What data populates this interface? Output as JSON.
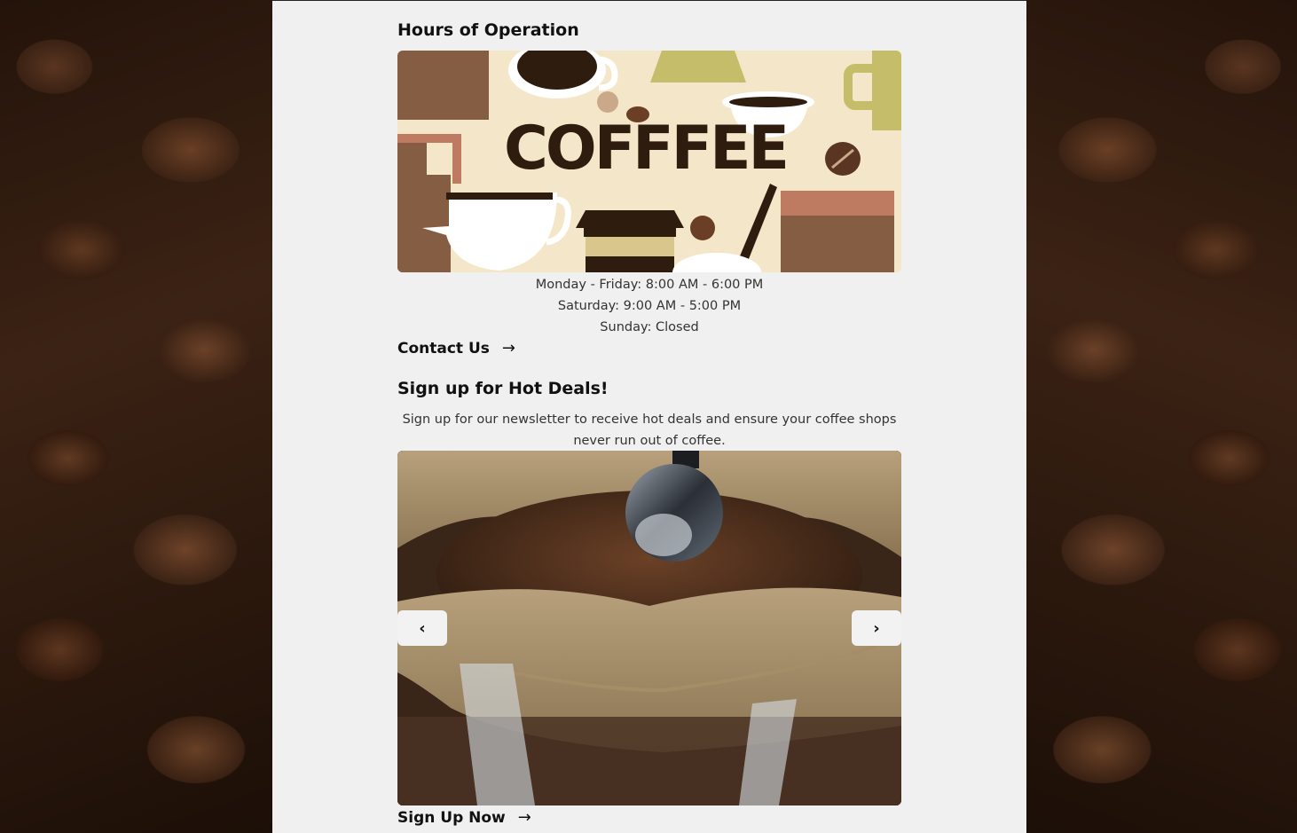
{
  "hours": {
    "title": "Hours of Operation",
    "banner_text": "COFFFEE",
    "lines": [
      "Monday - Friday: 8:00 AM - 6:00 PM",
      "Saturday: 9:00 AM - 5:00 PM",
      "Sunday: Closed"
    ]
  },
  "contact": {
    "label": "Contact Us",
    "arrow": "→"
  },
  "deals": {
    "title": "Sign up for Hot Deals!",
    "text": "Sign up for our newsletter to receive hot deals and ensure your coffee shops never run out of coffee."
  },
  "carousel": {
    "prev_icon": "‹",
    "next_icon": "›"
  },
  "signup": {
    "label": "Sign Up Now",
    "arrow": "→"
  },
  "colors": {
    "page_bg": "#f0f0f0",
    "dark_brown": "#2e1d0f",
    "mid_brown": "#845d43",
    "cream": "#f4e7c9",
    "olive": "#c5bd6a",
    "terracotta": "#bf7b62"
  }
}
